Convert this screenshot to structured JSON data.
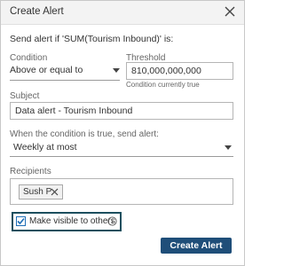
{
  "dialog": {
    "title": "Create Alert"
  },
  "description": "Send alert if 'SUM(Tourism Inbound)' is:",
  "condition": {
    "label": "Condition",
    "value": "Above or equal to"
  },
  "threshold": {
    "label": "Threshold",
    "value": "810,000,000,000",
    "hint": "Condition currently true"
  },
  "subject": {
    "label": "Subject",
    "value": "Data alert - Tourism Inbound"
  },
  "frequency": {
    "label": "When the condition is true, send alert:",
    "value": "Weekly at most"
  },
  "recipients": {
    "label": "Recipients",
    "items": [
      {
        "name": "Sush P"
      }
    ]
  },
  "visibility": {
    "label": "Make visible to others",
    "checked": true
  },
  "actions": {
    "create_label": "Create Alert"
  },
  "colors": {
    "primary_button": "#1f4e79",
    "checkbox_accent": "#1f6fb6",
    "focus_outline": "#1c4f5e"
  }
}
